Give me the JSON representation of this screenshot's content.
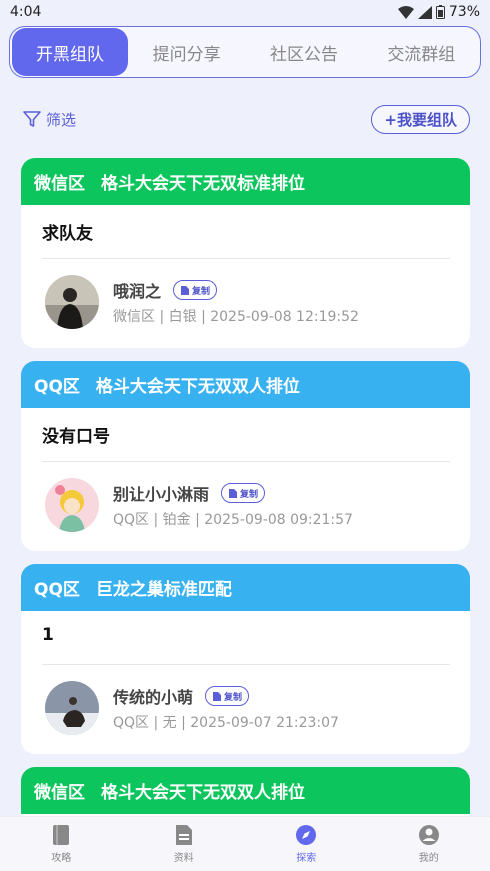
{
  "status": {
    "time": "4:04",
    "battery": "73%"
  },
  "tabs": [
    {
      "label": "开黑组队",
      "active": true
    },
    {
      "label": "提问分享",
      "active": false
    },
    {
      "label": "社区公告",
      "active": false
    },
    {
      "label": "交流群组",
      "active": false
    }
  ],
  "filter_label": "筛选",
  "team_button_label": "+我要组队",
  "copy_label": "复制",
  "colors": {
    "wechat": "#0cc55c",
    "qq": "#38b1f0",
    "accent": "#6168ee"
  },
  "cards": [
    {
      "zone": "微信区",
      "mode": "格斗大会天下无双标准排位",
      "title": "求队友",
      "user": "哦润之",
      "meta": "微信区 | 白银 | 2025-09-08 12:19:52"
    },
    {
      "zone": "QQ区",
      "mode": "格斗大会天下无双双人排位",
      "title": "没有口号",
      "user": "别让小小淋雨",
      "meta": "QQ区 | 铂金 | 2025-09-08 09:21:57"
    },
    {
      "zone": "QQ区",
      "mode": "巨龙之巢标准匹配",
      "title": "1",
      "user": "传统的小萌",
      "meta": "QQ区 | 无 | 2025-09-07 21:23:07"
    },
    {
      "zone": "微信区",
      "mode": "格斗大会天下无双双人排位"
    }
  ],
  "nav": [
    {
      "label": "攻略",
      "icon": "book-icon"
    },
    {
      "label": "资料",
      "icon": "document-icon"
    },
    {
      "label": "探索",
      "icon": "compass-icon",
      "active": true
    },
    {
      "label": "我的",
      "icon": "profile-icon"
    }
  ]
}
